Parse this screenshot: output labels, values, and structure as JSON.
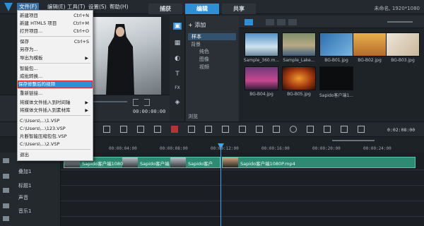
{
  "title_bar": {
    "menus": [
      "文件(F)",
      "编辑(E)",
      "工具(T)",
      "设置(S)",
      "帮助(H)"
    ],
    "tabs": [
      "捕获",
      "编辑",
      "共享"
    ],
    "project_info": "未命名, 1920*1080"
  },
  "preview": {
    "timecode": "00:00:00:00"
  },
  "library": {
    "add_label": "添加",
    "folders": [
      "样本",
      "背景",
      "纯色",
      "图像",
      "视频"
    ],
    "browse_label": "浏览",
    "side_icons": [
      "media-icon",
      "transition-icon",
      "filter-icon",
      "title-icon",
      "fx-icon",
      "graphic-icon"
    ],
    "thumbnails": [
      "Sample_360.m...",
      "Sample_Lake...",
      "BG-B01.jpg",
      "BG-B02.jpg",
      "BG-B03.jpg",
      "BG-B04.jpg",
      "BG-B05.jpg",
      "Sapido客户端1..."
    ]
  },
  "timeline": {
    "duration": "0:02:08:00",
    "ruler_ticks": [
      "00:00:04:00",
      "00:00:08:00",
      "00:00:12:00",
      "00:00:16:00",
      "00:00:20:00",
      "00:00:24:00"
    ],
    "tracks": [
      "叠加1",
      "标题1",
      "声音",
      "音乐1"
    ],
    "clips": [
      "Sapido客户端1080",
      "Sapido客户端",
      "Sapido客户",
      "Sapido客户端1080P.mp4"
    ]
  },
  "file_menu": {
    "items": [
      {
        "label": "新建项目",
        "shortcut": "Ctrl+N"
      },
      {
        "label": "新建 HTML5 项目",
        "shortcut": "Ctrl+M"
      },
      {
        "label": "打开项目...",
        "shortcut": "Ctrl+O"
      },
      {
        "label": "保存",
        "shortcut": "Ctrl+S"
      },
      {
        "label": "另存为...",
        "shortcut": ""
      },
      {
        "label": "导出为模板",
        "shortcut": ""
      },
      {
        "label": "智能包...",
        "shortcut": ""
      },
      {
        "label": "成批转换...",
        "shortcut": ""
      },
      {
        "label": "保存修整后的视频",
        "shortcut": ""
      },
      {
        "label": "重新链接...",
        "shortcut": ""
      },
      {
        "label": "将媒体文件插入到时间轴",
        "shortcut": ""
      },
      {
        "label": "将媒体文件插入到素材库",
        "shortcut": ""
      },
      {
        "label": "C:\\Users\\...\\1.VSP",
        "shortcut": ""
      },
      {
        "label": "C:\\Users\\...\\123.VSP",
        "shortcut": ""
      },
      {
        "label": "片断智能压缩包包.VSP",
        "shortcut": ""
      },
      {
        "label": "C:\\Users\\...\\2.VSP",
        "shortcut": ""
      },
      {
        "label": "退出",
        "shortcut": ""
      }
    ]
  }
}
